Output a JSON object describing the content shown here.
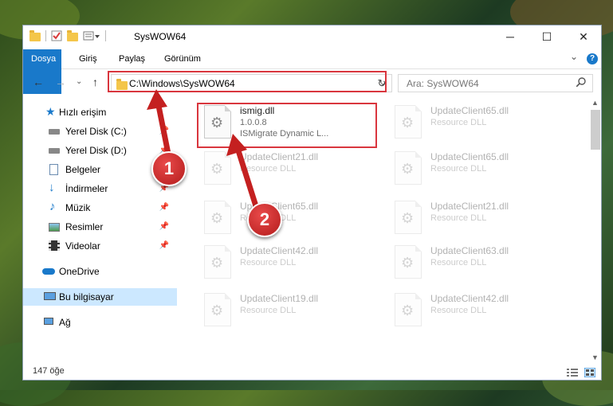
{
  "window": {
    "title": "SysWOW64",
    "minimize": "─",
    "maximize": "☐",
    "close": "✕"
  },
  "ribbon": {
    "tabs": [
      "Dosya",
      "Giriş",
      "Paylaş",
      "Görünüm"
    ],
    "collapse": "⌄",
    "help": "?"
  },
  "nav": {
    "back": "←",
    "forward": "→",
    "recent": "⌄",
    "up": "↑",
    "address": "C:\\Windows\\SysWOW64",
    "refresh": "↻",
    "search_placeholder": "Ara: SysWOW64"
  },
  "sidebar": {
    "quick_access": "Hızlı erişim",
    "items": [
      "Yerel Disk (C:)",
      "Yerel Disk (D:)",
      "Belgeler",
      "İndirmeler",
      "Müzik",
      "Resimler",
      "Videolar"
    ],
    "onedrive": "OneDrive",
    "this_pc": "Bu bilgisayar",
    "network": "Ağ"
  },
  "files": {
    "main": {
      "name": "ismig.dll",
      "version": "1.0.0.8",
      "description": "ISMigrate Dynamic L..."
    },
    "left": [
      {
        "name": "UpdateClient21.dll",
        "type": "Resource DLL"
      },
      {
        "name": "UpdateClient65.dll",
        "type": "Resource DLL"
      },
      {
        "name": "UpdateClient42.dll",
        "type": "Resource DLL"
      },
      {
        "name": "UpdateClient19.dll",
        "type": "Resource DLL"
      }
    ],
    "right": [
      {
        "name": "UpdateClient65.dll",
        "type": "Resource DLL"
      },
      {
        "name": "UpdateClient65.dll",
        "type": "Resource DLL"
      },
      {
        "name": "UpdateClient21.dll",
        "type": "Resource DLL"
      },
      {
        "name": "UpdateClient63.dll",
        "type": "Resource DLL"
      },
      {
        "name": "UpdateClient42.dll",
        "type": "Resource DLL"
      }
    ]
  },
  "status": {
    "count": "147 öğe"
  },
  "callouts": [
    "1",
    "2"
  ],
  "colors": {
    "accent": "#1979ca",
    "highlight": "#d9363e",
    "selected": "#cce8ff"
  }
}
